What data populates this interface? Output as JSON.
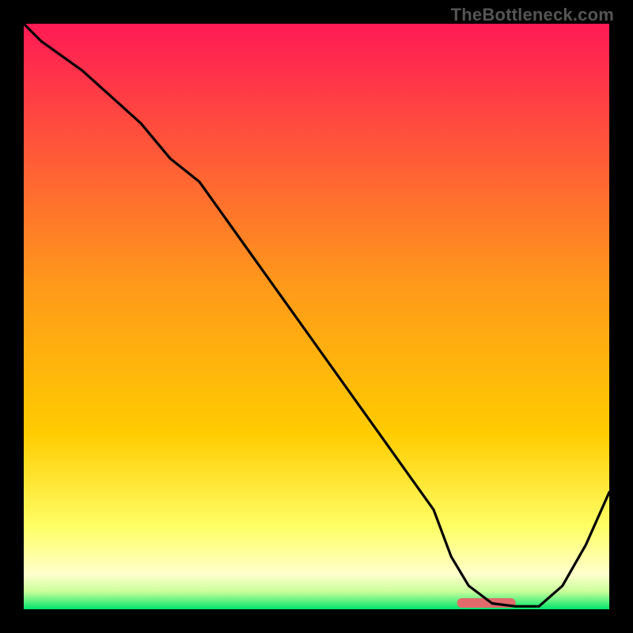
{
  "watermark": "TheBottleneck.com",
  "chart_data": {
    "type": "line",
    "title": "",
    "xlabel": "",
    "ylabel": "",
    "xlim": [
      0,
      100
    ],
    "ylim": [
      0,
      100
    ],
    "grid": false,
    "legend": false,
    "background_gradient": {
      "top_color": "#ff1a55",
      "mid_color": "#ffcc00",
      "lower_color": "#ffff66",
      "bottom_color": "#00e56b"
    },
    "marker": {
      "x": 79,
      "width_pct": 10,
      "color": "#e26a6a"
    },
    "series": [
      {
        "name": "curve",
        "color": "#000000",
        "x": [
          0,
          3,
          10,
          20,
          25,
          30,
          40,
          50,
          60,
          70,
          73,
          76,
          80,
          84,
          88,
          92,
          96,
          100
        ],
        "values": [
          100,
          97,
          92,
          83,
          77,
          73,
          59,
          45,
          31,
          17,
          9,
          4,
          1,
          0.5,
          0.5,
          4,
          11,
          20
        ]
      }
    ]
  }
}
